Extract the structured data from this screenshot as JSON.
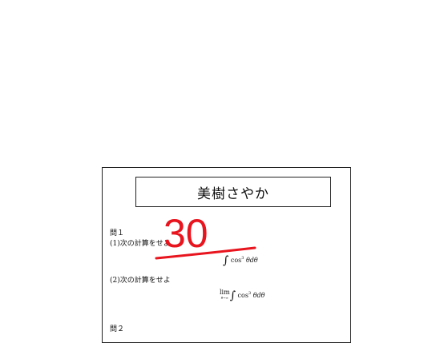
{
  "student": {
    "name": "美樹さやか"
  },
  "questions": {
    "q1_label": "問１",
    "q1_part1": "(1)次の計算をせよ",
    "q1_part2": "(2)次の計算をせよ",
    "q2_label": "問２"
  },
  "formulas": {
    "integral_symbol": "∫",
    "f1_func": "cos",
    "f1_power": "3",
    "f1_tail": "θdθ",
    "f2_lim": "lim",
    "f2_lim_sub": "θ→∞",
    "f2_func": "cos",
    "f2_power": "3",
    "f2_tail": "θdθ"
  },
  "grade": {
    "score": "30",
    "color": "#e8141e"
  }
}
